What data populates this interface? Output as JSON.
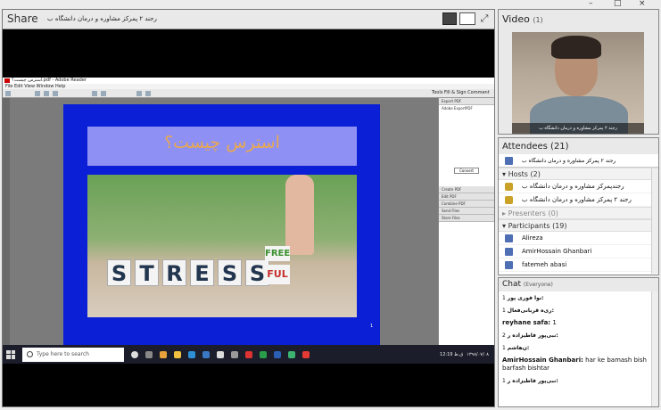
{
  "window_controls": {
    "minimize": "–",
    "restore": "□",
    "close": "×"
  },
  "share": {
    "title": "Share",
    "presenter_name": "رجند ۲ پمرکز مشاوره و درمان دانشگاه ب",
    "adobe": {
      "title": "استرس چیست؟.pdf - Adobe Reader",
      "menu": "File  Edit  View  Window  Help",
      "toolbar_right": "Tools   Fill & Sign   Comment",
      "side_panel": {
        "export": "Export PDF",
        "brand": "Adobe ExportPDF",
        "convert": "Convert",
        "create": "Create PDF",
        "edit": "Edit PDF",
        "combine": "Combine PDF",
        "send": "Send Files",
        "store": "Store Files"
      }
    },
    "slide": {
      "title": "استرس چیست؟",
      "dice": [
        "S",
        "T",
        "R",
        "E",
        "S",
        "S"
      ],
      "free": "FREE",
      "ful": "FUL",
      "page": "1"
    },
    "taskbar": {
      "search_placeholder": "Type here to search",
      "time": "12:19 ق.ظ",
      "date": "۱۳۹۸/۰۷/۰۸"
    }
  },
  "video": {
    "title": "Video",
    "count": "(1)",
    "name": "رجند ۲ پمرکز مشاوره و درمان دانشگاه ب"
  },
  "attendees": {
    "title": "Attendees (21)",
    "me": "رجند ۲ پمرکز مشاوره و درمان دانشگاه ب",
    "hosts_label": "Hosts (2)",
    "hosts": [
      "رجندپمرکز مشاوره و درمان دانشگاه ب",
      "رجند ۲ پمرکز مشاوره و درمان دانشگاه ب"
    ],
    "presenters_label": "Presenters (0)",
    "participants_label": "Participants (19)",
    "participants": [
      "Alireza",
      "AmirHossain Ghanbari",
      "fatemeh abasi"
    ]
  },
  "chat": {
    "title": "Chat",
    "scope": "(Everyone)",
    "messages": [
      {
        "who": "نوا فوری پور:",
        "text": "1"
      },
      {
        "who": "ری‌ه قربانی‌فعال:",
        "text": "1"
      },
      {
        "who": "reyhane safa:",
        "text": "1"
      },
      {
        "who": "نبی‌پور فاطیزاده ر:",
        "text": "2"
      },
      {
        "who": "ن‌هاشم:",
        "text": "1"
      },
      {
        "who": "AmirHossain Ghanbari:",
        "text": "har ke bamash bish barfash bishtar"
      },
      {
        "who": "نبی‌پور فاطیزاده ر:",
        "text": "1"
      }
    ]
  }
}
